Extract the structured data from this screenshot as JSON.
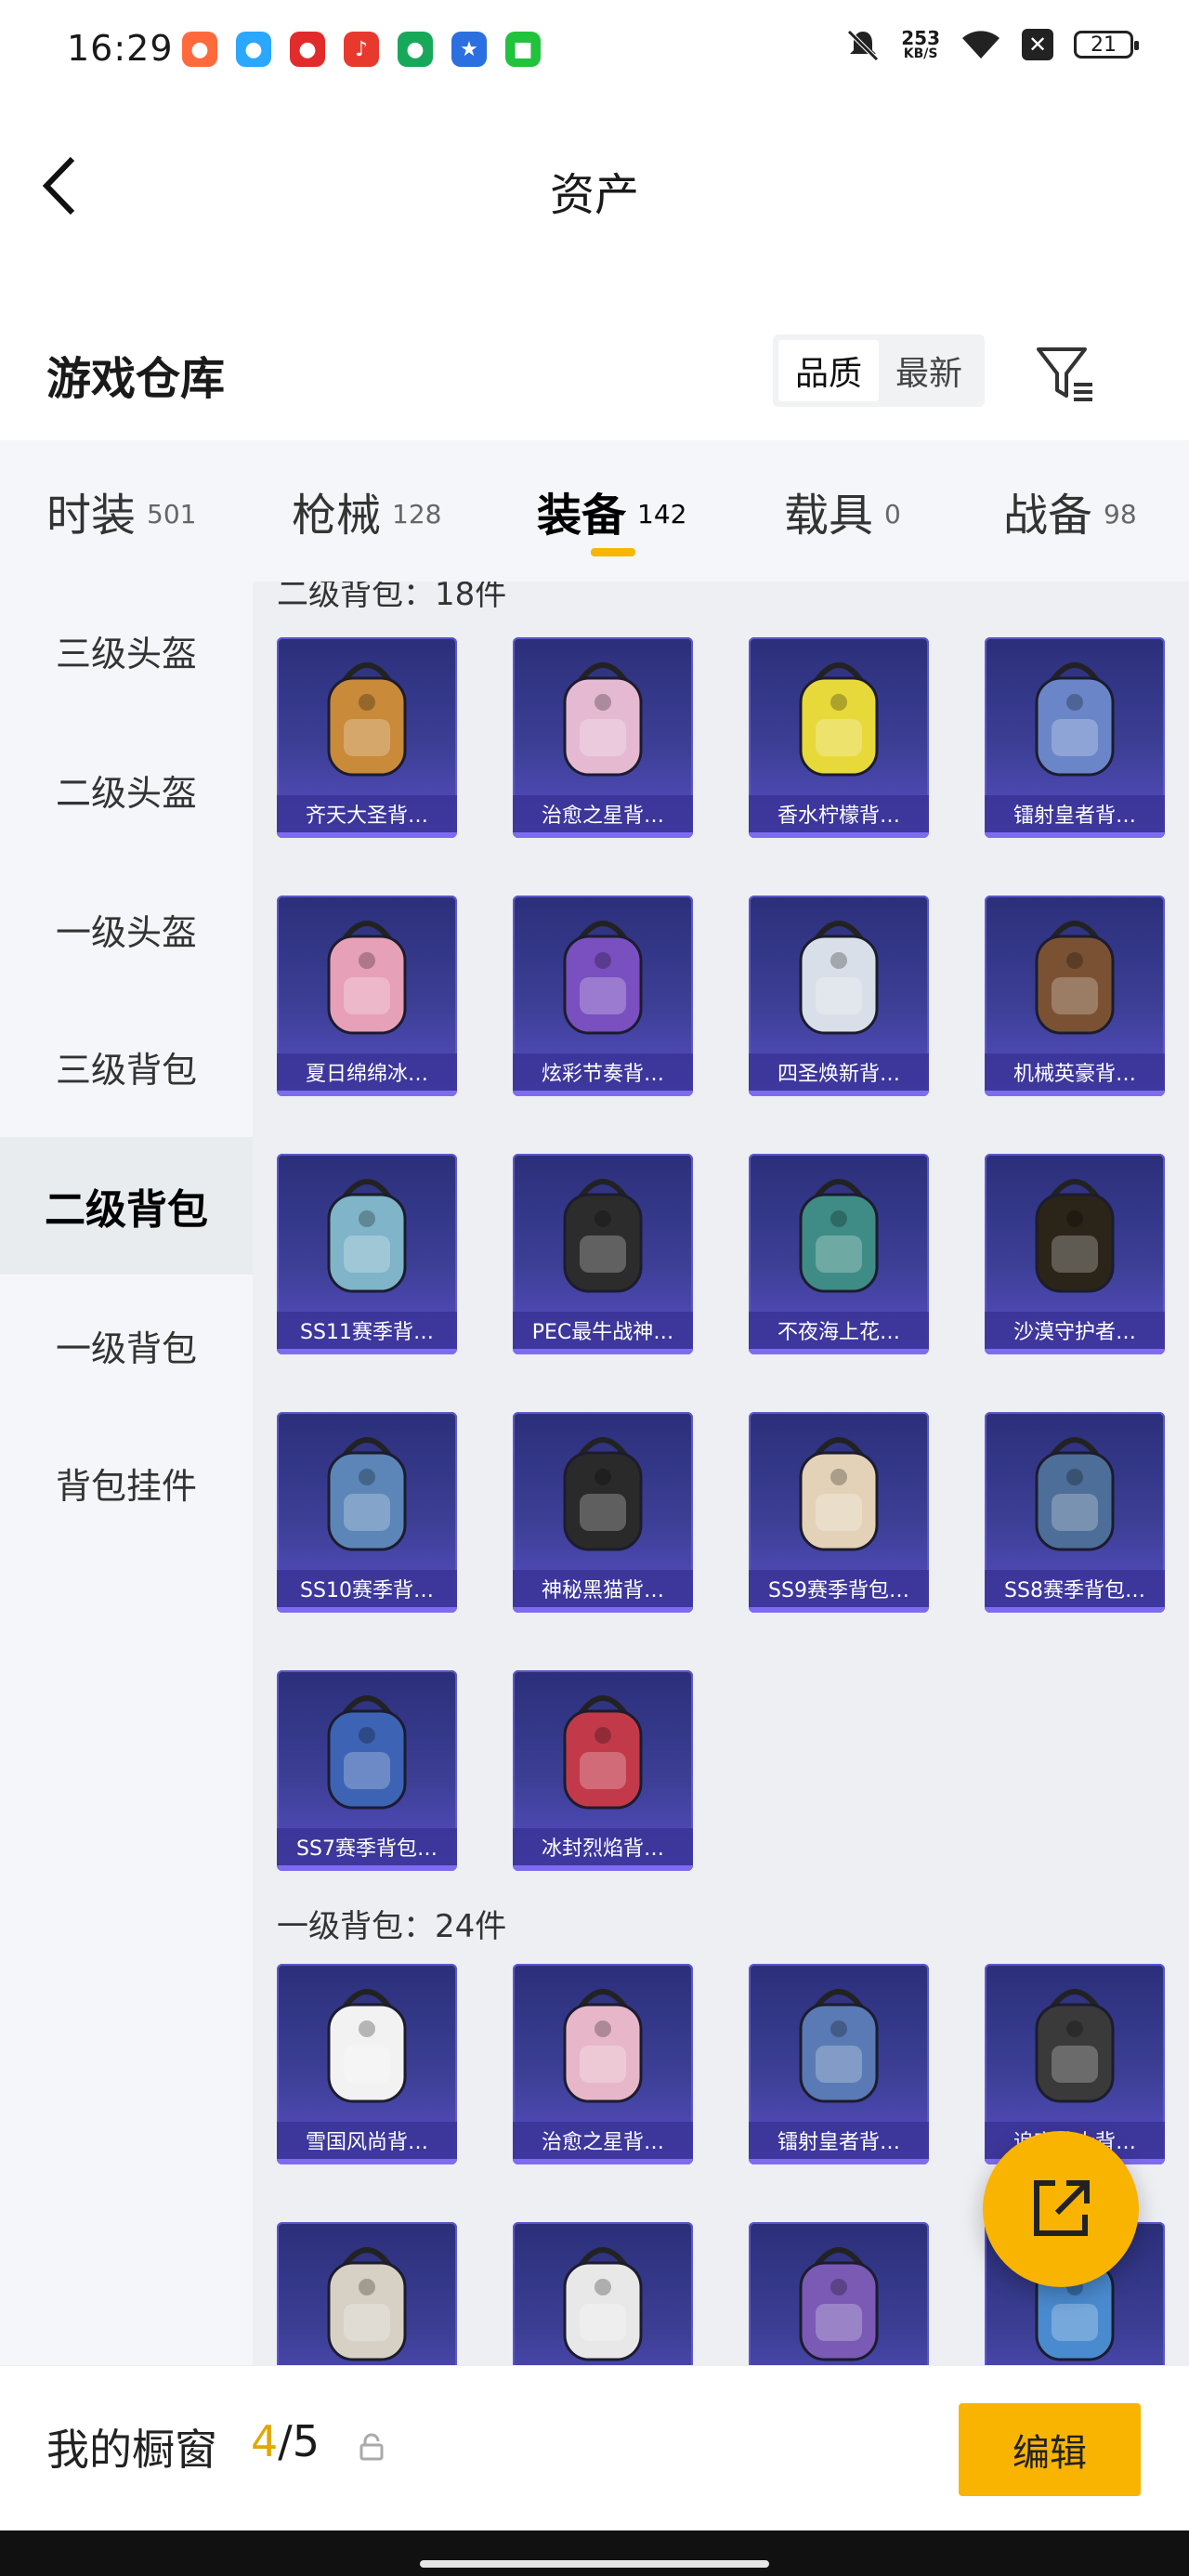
{
  "status_bar": {
    "time": "16:29",
    "net_speed_value": "253",
    "net_speed_unit": "KB/S",
    "battery": "21"
  },
  "header": {
    "title": "资产"
  },
  "warehouse": {
    "title": "游戏仓库",
    "sort_quality": "品质",
    "sort_latest": "最新"
  },
  "tabs": [
    {
      "label": "时装",
      "count": "501"
    },
    {
      "label": "枪械",
      "count": "128"
    },
    {
      "label": "装备",
      "count": "142"
    },
    {
      "label": "载具",
      "count": "0"
    },
    {
      "label": "战备",
      "count": "98"
    }
  ],
  "sidebar": {
    "items": [
      {
        "label": "三级头盔"
      },
      {
        "label": "二级头盔"
      },
      {
        "label": "一级头盔"
      },
      {
        "label": "三级背包"
      },
      {
        "label": "二级背包"
      },
      {
        "label": "一级背包"
      },
      {
        "label": "背包挂件"
      }
    ]
  },
  "groups": [
    {
      "title": "二级背包：18件",
      "items": [
        {
          "label": "齐天大圣背…"
        },
        {
          "label": "治愈之星背…"
        },
        {
          "label": "香水柠檬背…"
        },
        {
          "label": "镭射皇者背…"
        },
        {
          "label": "夏日绵绵冰…"
        },
        {
          "label": "炫彩节奏背…"
        },
        {
          "label": "四圣焕新背…"
        },
        {
          "label": "机械英豪背…"
        },
        {
          "label": "SS11赛季背…"
        },
        {
          "label": "PEC最牛战神…"
        },
        {
          "label": "不夜海上花…"
        },
        {
          "label": "沙漠守护者…"
        },
        {
          "label": "SS10赛季背…"
        },
        {
          "label": "神秘黑猫背…"
        },
        {
          "label": "SS9赛季背包…"
        },
        {
          "label": "SS8赛季背包…"
        },
        {
          "label": "SS7赛季背包…"
        },
        {
          "label": "冰封烈焰背…"
        }
      ]
    },
    {
      "title": "一级背包：24件",
      "items": [
        {
          "label": "雪国风尚背…"
        },
        {
          "label": "治愈之星背…"
        },
        {
          "label": "镭射皇者背…"
        },
        {
          "label": "追寂战士背…"
        },
        {
          "label": ""
        },
        {
          "label": ""
        },
        {
          "label": ""
        },
        {
          "label": ""
        }
      ]
    }
  ],
  "bottom": {
    "showcase_label": "我的橱窗",
    "showcase_current": "4",
    "showcase_sep": "/",
    "showcase_total": "5",
    "edit_label": "编辑"
  },
  "colors": {
    "accent": "#f8b400",
    "card_bg": "#3c3f95",
    "card_label_bg": "#3a3496"
  }
}
